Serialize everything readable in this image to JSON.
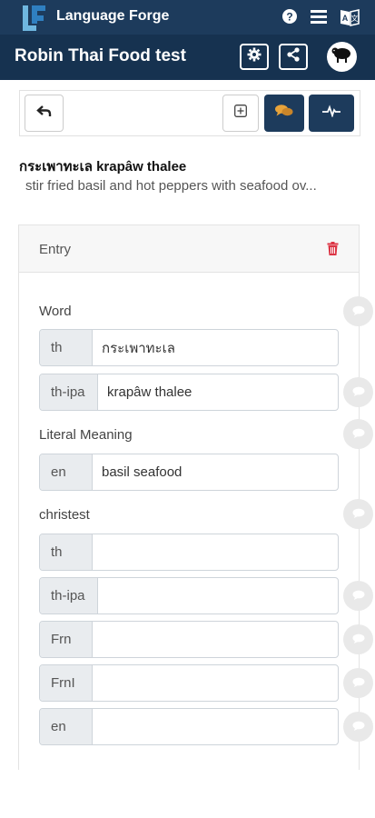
{
  "app": {
    "name": "Language Forge"
  },
  "header": {
    "project_title": "Robin Thai Food test",
    "icons": [
      "help-icon",
      "hamburger-menu-icon",
      "language-icon",
      "settings-gear-icon",
      "share-icon",
      "avatar-sheep-icon"
    ]
  },
  "toolbar": {
    "icons": [
      "back-arrow-icon",
      "expand-fields-icon",
      "comments-icon",
      "activity-icon"
    ]
  },
  "word": {
    "headword": "กระเพาทะเล krapâw thalee",
    "summary": "stir fried basil and hot peppers with seafood ov..."
  },
  "entry": {
    "header_label": "Entry",
    "fields": [
      {
        "label": "Word",
        "inputs": [
          {
            "lang": "th",
            "value": "กระเพาทะเล"
          },
          {
            "lang": "th-ipa",
            "value": "krapâw thalee"
          }
        ]
      },
      {
        "label": "Literal Meaning",
        "inputs": [
          {
            "lang": "en",
            "value": "basil seafood"
          }
        ]
      },
      {
        "label": "christest",
        "inputs": [
          {
            "lang": "th",
            "value": ""
          },
          {
            "lang": "th-ipa",
            "value": ""
          },
          {
            "lang": "Frn",
            "value": ""
          },
          {
            "lang": "FrnI",
            "value": ""
          },
          {
            "lang": "en",
            "value": ""
          }
        ]
      }
    ]
  },
  "colors": {
    "topbar": "#1d3b5c",
    "projbar": "#163250",
    "accent_dark": "#1d3b5c",
    "comment_icon": "#e8a33a",
    "delete_icon": "#dc3545"
  }
}
